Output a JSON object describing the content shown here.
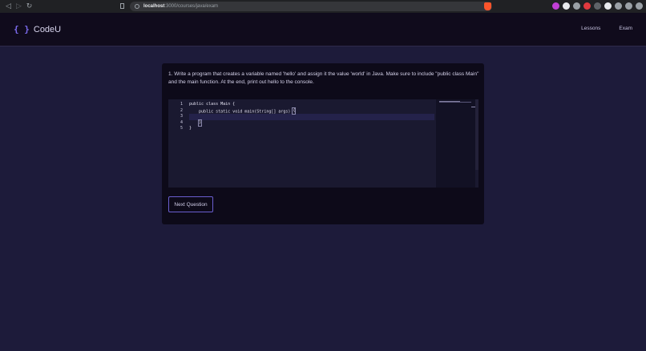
{
  "browser": {
    "url_host": "localhost",
    "url_path": ":3000/courses/java/exam",
    "extension_colors": [
      "#c13fd6",
      "#e8eaed",
      "#9aa0a6",
      "#e0393e",
      "#5f6368",
      "#e8eaed",
      "#9aa0a6",
      "#9aa0a6",
      "#9aa0a6"
    ]
  },
  "header": {
    "logo_icon": "{ }",
    "brand": "CodeU",
    "nav": [
      "Lessons",
      "Exam"
    ]
  },
  "question": {
    "text": "1. Write a program that creates a variable named 'hello' and assign it the value 'world' in Java. Make sure to include \"public class Main\" and the main function. At the end, print out hello to the console."
  },
  "editor": {
    "line_numbers": [
      "1",
      "2",
      "3",
      "4",
      "5"
    ],
    "lines": [
      "public class Main {",
      "    public static void main(String[] args) ",
      "",
      "    ",
      "}"
    ],
    "line2_brace": "{",
    "line4_brace": "}"
  },
  "actions": {
    "next_label": "Next Question"
  },
  "colors": {
    "background": "#1d1b3a",
    "header": "#100b1c",
    "card": "#0d0a19",
    "accent": "#6a5ecf"
  }
}
